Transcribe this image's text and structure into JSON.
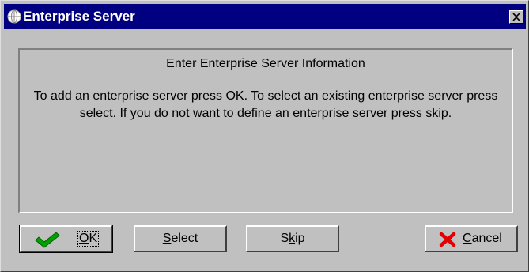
{
  "window": {
    "title": "Enterprise Server",
    "title_icon": "globe-icon",
    "close_icon": "close-icon"
  },
  "panel": {
    "heading": "Enter Enterprise Server Information",
    "message": "To add an enterprise server press OK.  To select an existing enterprise server press select.  If you do not want to define an enterprise server press skip."
  },
  "buttons": {
    "ok": {
      "mnemonic": "O",
      "rest": "K",
      "icon": "checkmark-icon",
      "icon_color": "#008000"
    },
    "select": {
      "mnemonic": "S",
      "rest": "elect"
    },
    "skip": {
      "pre": "S",
      "mnemonic": "k",
      "rest": "ip"
    },
    "cancel": {
      "mnemonic": "C",
      "rest": "ancel",
      "icon": "x-icon",
      "icon_color": "#e00000"
    }
  },
  "colors": {
    "titlebar": "#000080",
    "face": "#c0c0c0"
  }
}
